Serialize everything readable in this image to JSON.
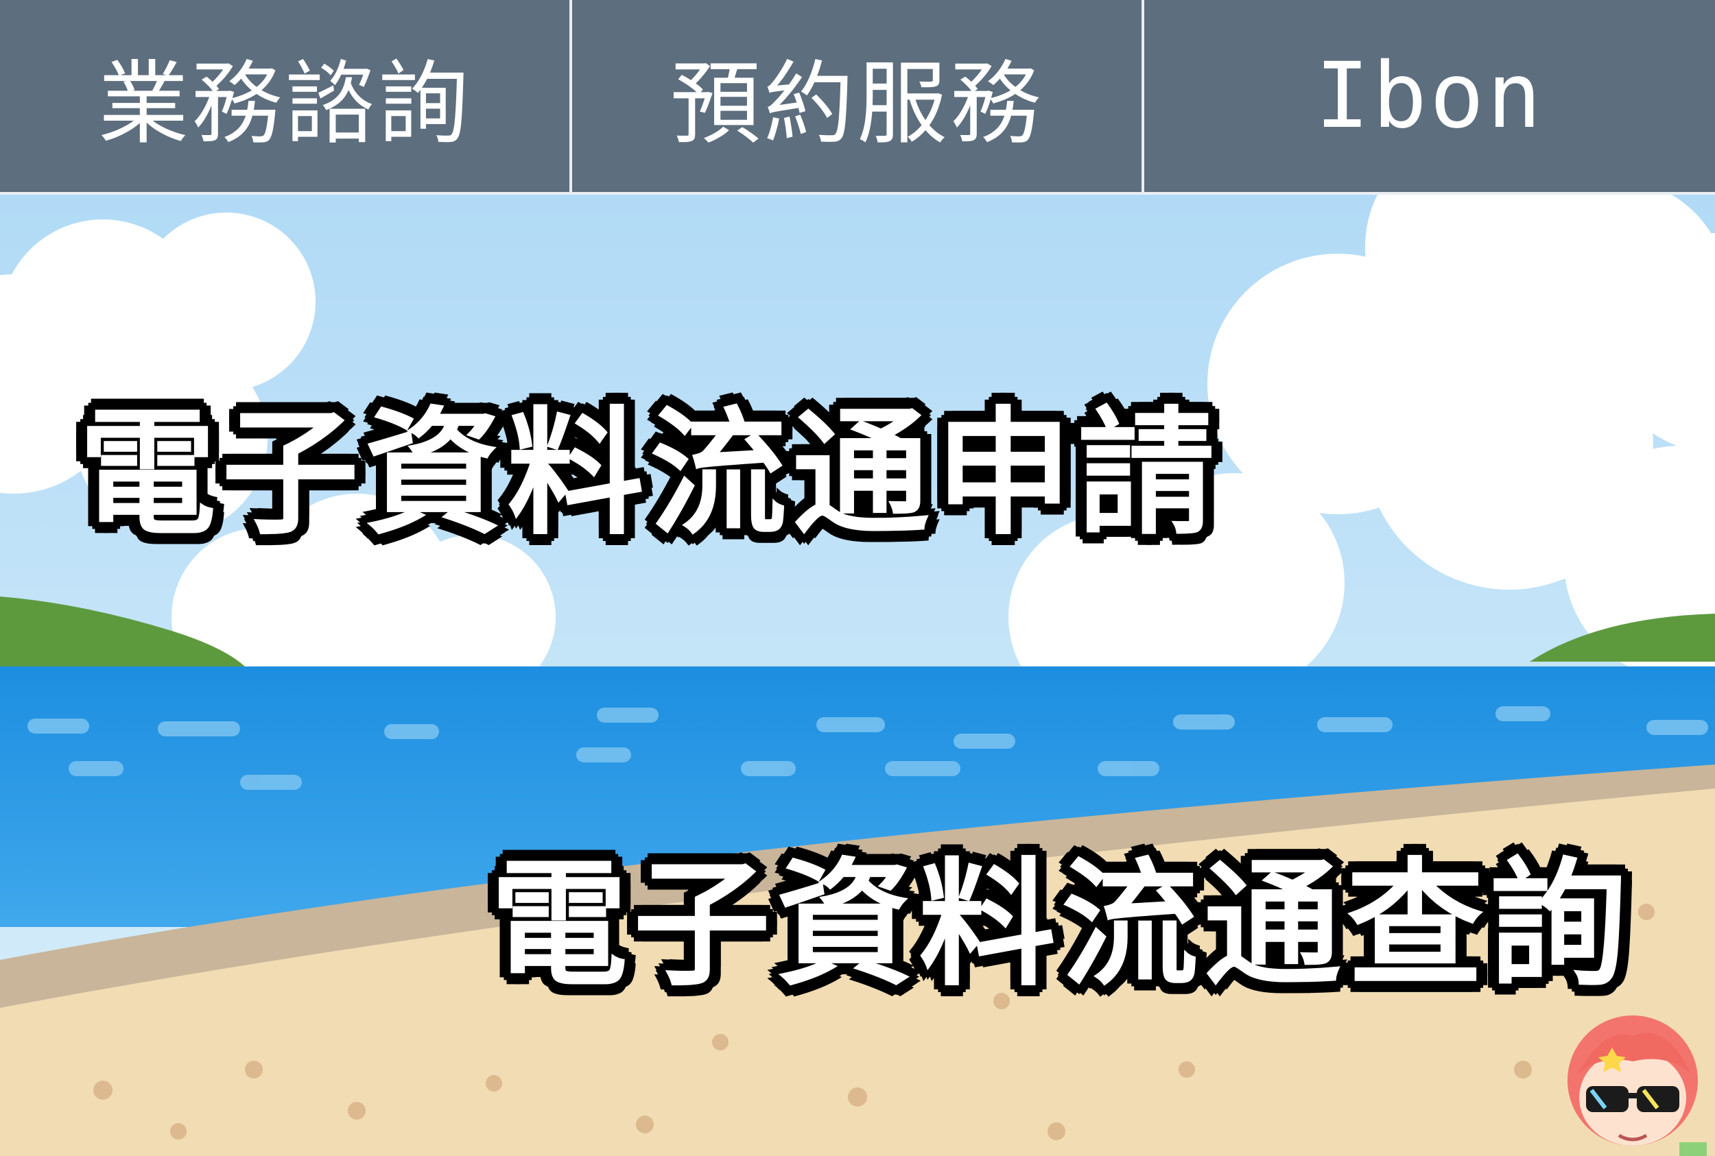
{
  "nav": {
    "tabs": [
      {
        "label": "業務諮詢"
      },
      {
        "label": "預約服務"
      },
      {
        "label": "Ibon"
      }
    ]
  },
  "banners": {
    "apply_label": "電子資料流通申請",
    "query_label": "電子資料流通查詢"
  },
  "colors": {
    "nav_bg": "#5d6e7e",
    "nav_divider": "#e9eef2",
    "sky": "#bfe3f7",
    "sea": "#1f8fe0",
    "sand": "#f3ddb4"
  },
  "icons": {
    "mascot": "mascot-character-icon"
  }
}
